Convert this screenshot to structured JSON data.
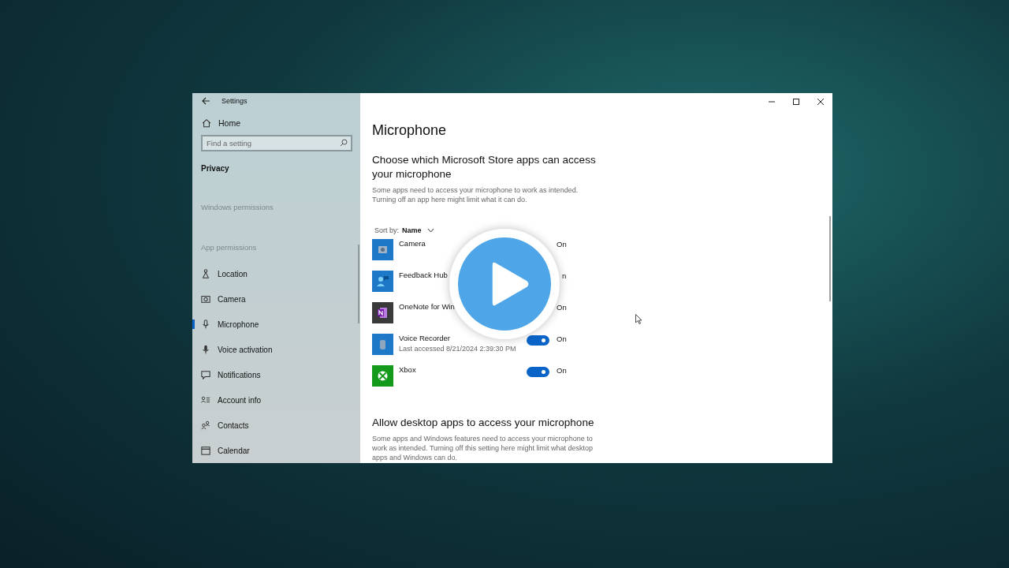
{
  "window": {
    "title": "Settings"
  },
  "sidebar": {
    "home": "Home",
    "search": {
      "placeholder": "Find a setting"
    },
    "section": "Privacy",
    "group_1": "Windows permissions",
    "group_2": "App permissions",
    "items": [
      {
        "label": "Location",
        "kind": "location",
        "selected": false
      },
      {
        "label": "Camera",
        "kind": "camera",
        "selected": false
      },
      {
        "label": "Microphone",
        "kind": "microphone",
        "selected": true
      },
      {
        "label": "Voice activation",
        "kind": "voice",
        "selected": false
      },
      {
        "label": "Notifications",
        "kind": "notifications",
        "selected": false
      },
      {
        "label": "Account info",
        "kind": "account",
        "selected": false
      },
      {
        "label": "Contacts",
        "kind": "contacts",
        "selected": false
      },
      {
        "label": "Calendar",
        "kind": "calendar",
        "selected": false
      }
    ]
  },
  "content": {
    "title": "Microphone",
    "store_heading": "Choose which Microsoft Store apps can access your microphone",
    "store_description": "Some apps need to access your microphone to work as intended. Turning off an app here might limit what it can do.",
    "sort": {
      "label": "Sort by:",
      "value": "Name"
    },
    "apps": [
      {
        "name": "Camera",
        "kind": "camera",
        "status": "On"
      },
      {
        "name": "Feedback Hub",
        "kind": "feedback",
        "status": "n"
      },
      {
        "name": "OneNote for Win",
        "kind": "onenote",
        "status": "On"
      },
      {
        "name": "Voice Recorder",
        "kind": "recorder",
        "detail": "Last accessed 8/21/2024 2:39:30 PM",
        "on": true,
        "status": "On"
      },
      {
        "name": "Xbox",
        "kind": "xbox",
        "on": true,
        "status": "On"
      }
    ],
    "desktop_heading": "Allow desktop apps to access your microphone",
    "desktop_description": "Some apps and Windows features need to access your microphone to work as intended. Turning off this setting here might limit what desktop apps and Windows can do."
  }
}
